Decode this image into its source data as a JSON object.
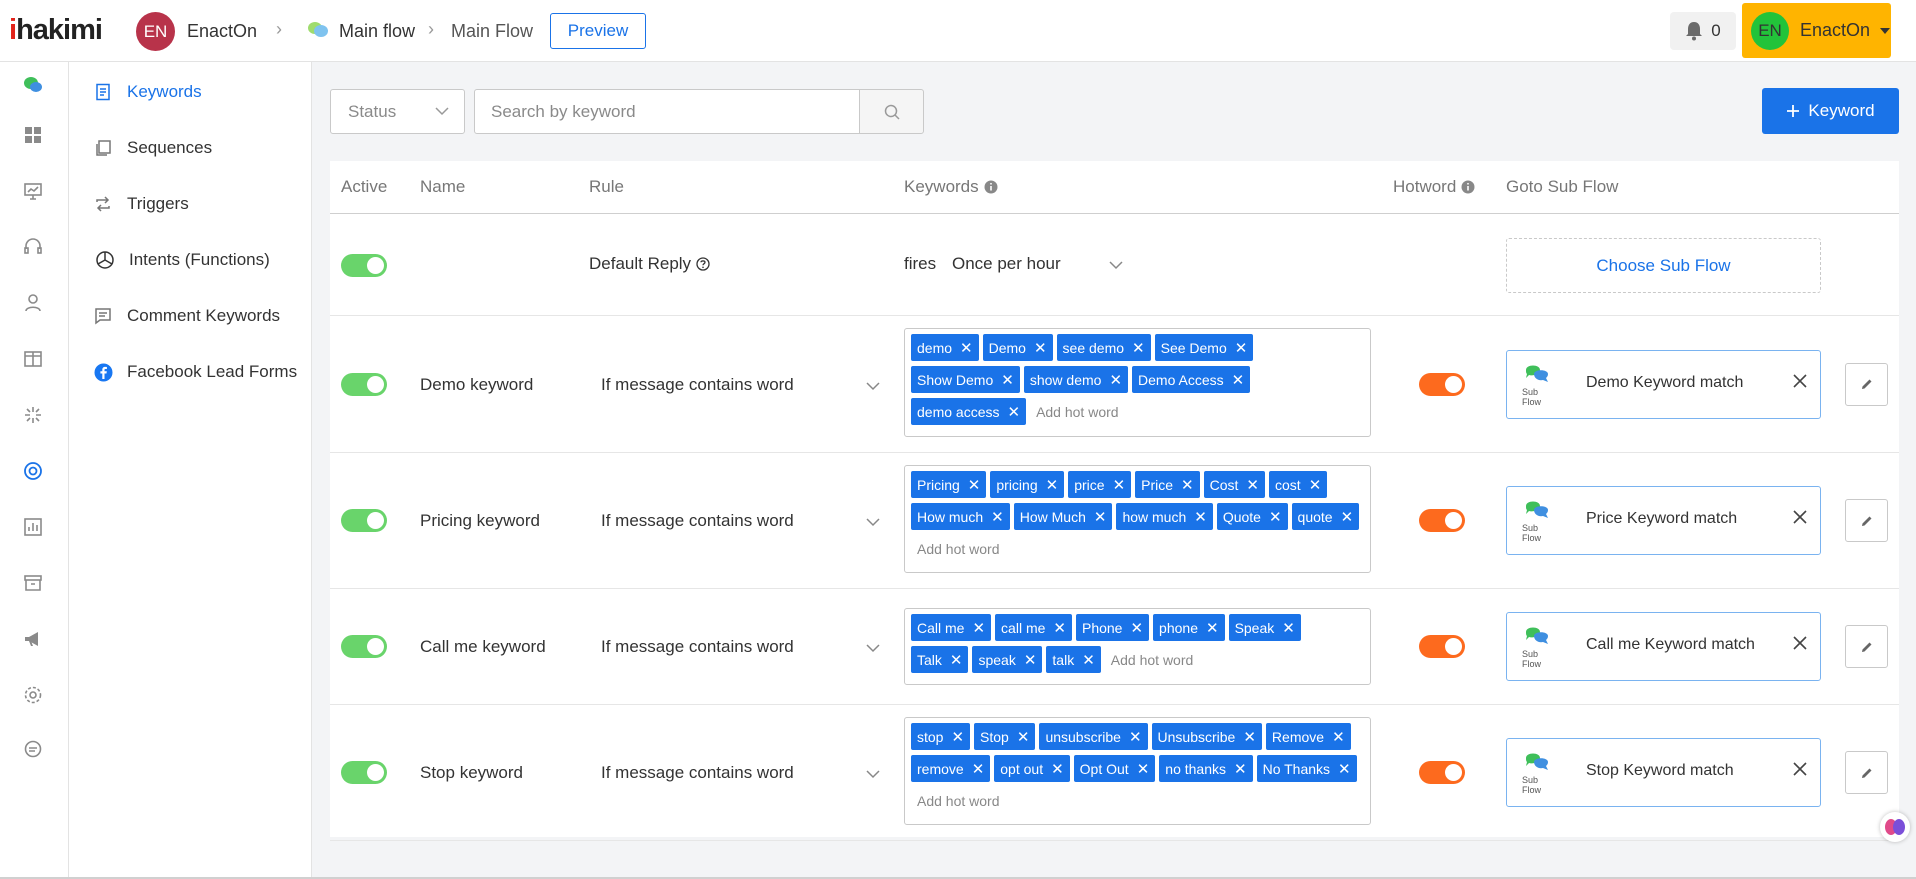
{
  "header": {
    "logo_prefix": "i",
    "logo_rest": "hakimi",
    "workspace_initials": "EN",
    "workspace_name": "EnactOn",
    "breadcrumb": [
      "Main flow",
      "Main Flow"
    ],
    "preview_label": "Preview",
    "notification_count": "0",
    "user_initials": "EN",
    "user_name": "EnactOn"
  },
  "colors": {
    "accent": "#1a73e8",
    "user_button": "#ffb400",
    "toggle_active": "#69d46b",
    "hotword_toggle": "#fd6a1e",
    "tag": "#1a73e8"
  },
  "rail_icons": [
    "chat-logo-icon",
    "dashboard-icon",
    "presentation-icon",
    "headset-icon",
    "user-icon",
    "columns-icon",
    "sparkle-icon",
    "lifebuoy-icon",
    "chart-icon",
    "archive-icon",
    "megaphone-icon",
    "settings-icon",
    "comment-icon"
  ],
  "sidebar": {
    "items": [
      {
        "label": "Keywords",
        "icon": "document-icon"
      },
      {
        "label": "Sequences",
        "icon": "copy-icon"
      },
      {
        "label": "Triggers",
        "icon": "repeat-icon"
      },
      {
        "label": "Intents (Functions)",
        "icon": "openai-icon"
      },
      {
        "label": "Comment Keywords",
        "icon": "comment-lines-icon"
      },
      {
        "label": "Facebook Lead Forms",
        "icon": "facebook-icon"
      }
    ]
  },
  "filters": {
    "status_placeholder": "Status",
    "search_placeholder": "Search by keyword",
    "add_keyword_label": "Keyword"
  },
  "table": {
    "headers": {
      "active": "Active",
      "name": "Name",
      "rule": "Rule",
      "keywords": "Keywords",
      "hotword": "Hotword",
      "subflow": "Goto Sub Flow"
    },
    "default_row": {
      "rule": "Default Reply",
      "fires_label": "fires",
      "fires_value": "Once per hour",
      "choose_subflow": "Choose Sub Flow"
    },
    "subflow_caption": "Sub Flow",
    "add_hot_word_placeholder": "Add hot word",
    "rows": [
      {
        "name": "Demo keyword",
        "rule": "If message contains word",
        "keywords": [
          "demo",
          "Demo",
          "see demo",
          "See Demo",
          "Show Demo",
          "show demo",
          "Demo Access",
          "demo access"
        ],
        "subflow": "Demo Keyword match"
      },
      {
        "name": "Pricing keyword",
        "rule": "If message contains word",
        "keywords": [
          "Pricing",
          "pricing",
          "price",
          "Price",
          "Cost",
          "cost",
          "How much",
          "How Much",
          "how much",
          "Quote",
          "quote"
        ],
        "subflow": "Price Keyword match"
      },
      {
        "name": "Call me keyword",
        "rule": "If message contains word",
        "keywords": [
          "Call me",
          "call me",
          "Phone",
          "phone",
          "Speak",
          "Talk",
          "speak",
          "talk"
        ],
        "subflow": "Call me Keyword match"
      },
      {
        "name": "Stop keyword",
        "rule": "If message contains word",
        "keywords": [
          "stop",
          "Stop",
          "unsubscribe",
          "Unsubscribe",
          "Remove",
          "remove",
          "opt out",
          "Opt Out",
          "no thanks",
          "No Thanks"
        ],
        "subflow": "Stop Keyword match"
      }
    ]
  }
}
